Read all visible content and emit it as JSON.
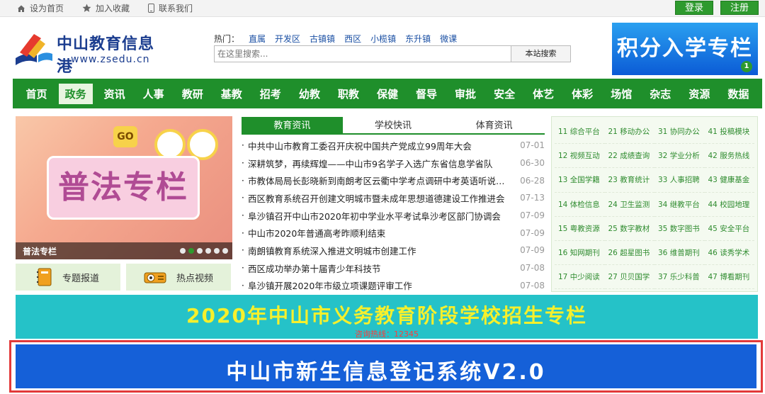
{
  "topbar": {
    "links": [
      "设为首页",
      "加入收藏",
      "联系我们"
    ],
    "login": "登录",
    "register": "注册"
  },
  "header": {
    "logo_cn": "中山教育信息港",
    "logo_url": "www.zsedu.cn",
    "hot_label": "热门：",
    "hot_links": [
      "直属",
      "开发区",
      "古镇镇",
      "西区",
      "小榄镇",
      "东升镇",
      "微课"
    ],
    "search_placeholder": "在这里搜索...",
    "search_button": "本站搜索",
    "banner_text": "积分入学专栏",
    "banner_badge": "1"
  },
  "nav": [
    "首页",
    "政务",
    "资讯",
    "人事",
    "教研",
    "基教",
    "招考",
    "幼教",
    "职教",
    "保健",
    "督导",
    "审批",
    "安全",
    "体艺",
    "体彩",
    "场馆",
    "杂志",
    "资源",
    "数据"
  ],
  "nav_active_index": 1,
  "promo": {
    "title": "普法专栏",
    "go": "GO",
    "caption": "普法专栏",
    "dots": 6,
    "active_dot": 1
  },
  "quick": [
    {
      "label": "专题报道",
      "icon": "notebook-icon"
    },
    {
      "label": "热点视频",
      "icon": "projector-icon"
    }
  ],
  "tabs": [
    "教育资讯",
    "学校快讯",
    "体育资讯"
  ],
  "news": [
    {
      "title": "中共中山市教育工委召开庆祝中国共产党成立99周年大会",
      "date": "07-01"
    },
    {
      "title": "深耕筑梦，再续辉煌——中山市9名学子入选广东省信息学省队",
      "date": "06-30"
    },
    {
      "title": "市教体局局长彭晓新到南朗考区云衢中学考点调研中考英语听说考试工作",
      "date": "06-28"
    },
    {
      "title": "西区教育系统召开创建文明城市暨未成年思想道德建设工作推进会",
      "date": "07-13"
    },
    {
      "title": "阜沙镇召开中山市2020年初中学业水平考试阜沙考区部门协调会",
      "date": "07-09"
    },
    {
      "title": "中山市2020年普通高考昨顺利结束",
      "date": "07-09"
    },
    {
      "title": "南朗镇教育系统深入推进文明城市创建工作",
      "date": "07-09"
    },
    {
      "title": "西区成功举办第十届青少年科技节",
      "date": "07-08"
    },
    {
      "title": "阜沙镇开展2020年市级立项课题评审工作",
      "date": "07-08"
    }
  ],
  "grid": [
    "11 综合平台",
    "21 移动办公",
    "31 协同办公",
    "41 投稿模块",
    "12 视频互动",
    "22 成绩查询",
    "32 学业分析",
    "42 服务热线",
    "13 全国学籍",
    "23 教育统计",
    "33 人事招聘",
    "43 健康基金",
    "14 体检信息",
    "24 卫生监测",
    "34 继教平台",
    "44 校园地理",
    "15 粤教资源",
    "25 数字教材",
    "35 数字图书",
    "45 安全平台",
    "16 知网期刊",
    "26 超星图书",
    "36 维普期刊",
    "46 读秀学术",
    "17 中少阅读",
    "27 贝贝国学",
    "37 乐少科普",
    "47 博看期刊"
  ],
  "banner1": {
    "title": "2020年中山市义务教育阶段学校招生专栏",
    "sub": "咨询热线：12345"
  },
  "banner2": {
    "title": "中山市新生信息登记系统V2.0"
  },
  "colors": {
    "green": "#1f8f2b",
    "blue": "#1560d8",
    "cyan": "#25c2c8",
    "red_outline": "#e23a3a"
  }
}
